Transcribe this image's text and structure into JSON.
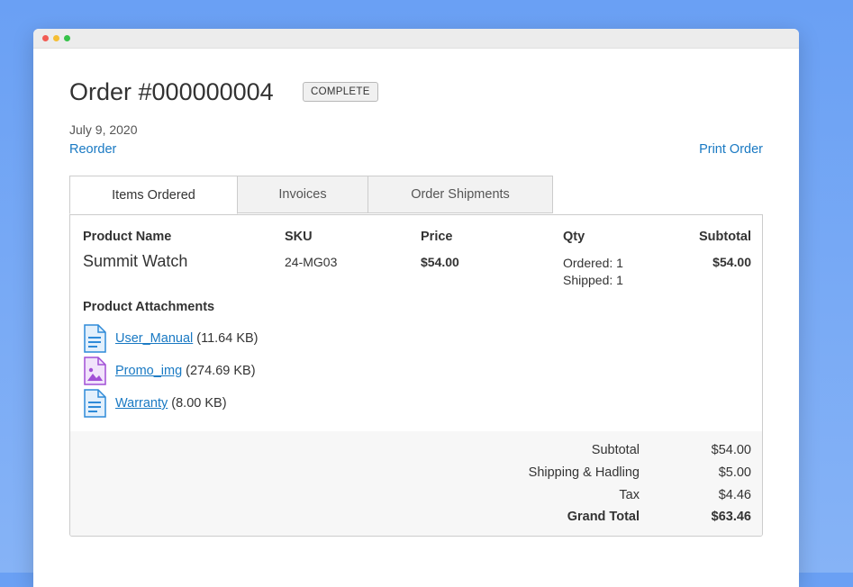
{
  "order": {
    "title": "Order #000000004",
    "status": "COMPLETE",
    "date": "July 9, 2020",
    "reorder_label": "Reorder",
    "print_label": "Print Order"
  },
  "tabs": [
    {
      "label": "Items Ordered"
    },
    {
      "label": "Invoices"
    },
    {
      "label": "Order Shipments"
    }
  ],
  "table": {
    "headers": {
      "product_name": "Product Name",
      "sku": "SKU",
      "price": "Price",
      "qty": "Qty",
      "subtotal": "Subtotal"
    },
    "item": {
      "name": "Summit Watch",
      "sku": "24-MG03",
      "price": "$54.00",
      "qty_ordered": "Ordered: 1",
      "qty_shipped": "Shipped: 1",
      "subtotal": "$54.00"
    }
  },
  "attachments": {
    "title": "Product Attachments",
    "items": [
      {
        "name": "User_Manual",
        "size": "(11.64 KB)",
        "icon": "document-icon"
      },
      {
        "name": "Promo_img",
        "size": "(274.69 KB)",
        "icon": "image-file-icon"
      },
      {
        "name": "Warranty",
        "size": "(8.00 KB)",
        "icon": "document-icon"
      }
    ]
  },
  "totals": {
    "subtotal_label": "Subtotal",
    "subtotal_value": "$54.00",
    "shipping_label": "Shipping & Hadling",
    "shipping_value": "$5.00",
    "tax_label": "Tax",
    "tax_value": "$4.46",
    "grand_label": "Grand Total",
    "grand_value": "$63.46"
  },
  "colors": {
    "link": "#1979c3",
    "background": "#6aa0f4"
  }
}
